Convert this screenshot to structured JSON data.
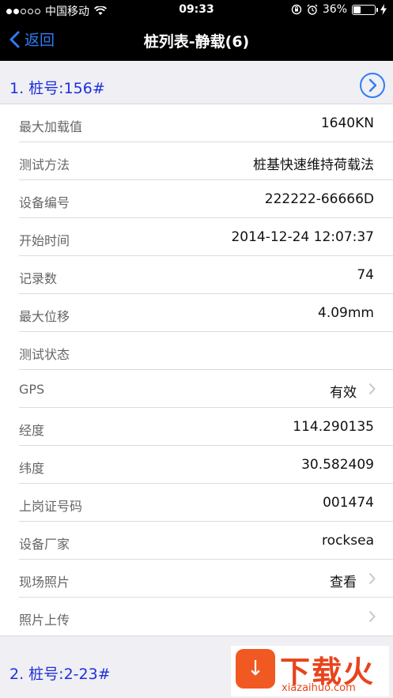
{
  "status_bar": {
    "carrier": "中国移动",
    "time": "09:33",
    "battery_percent": "36%",
    "battery_level": 0.36,
    "icons": [
      "signal-dots-icon",
      "wifi-icon",
      "rotation-lock-icon",
      "alarm-icon",
      "battery-icon",
      "charging-icon"
    ]
  },
  "nav": {
    "back_label": "返回",
    "title": "桩列表-静载(6)"
  },
  "sections": [
    {
      "title": "1. 桩号:156#",
      "rows": [
        {
          "label": "最大加载值",
          "value": "1640KN",
          "chevron": false
        },
        {
          "label": "测试方法",
          "value": "桩基快速维持荷载法",
          "chevron": false
        },
        {
          "label": "设备编号",
          "value": "222222-66666D",
          "chevron": false
        },
        {
          "label": "开始时间",
          "value": "2014-12-24 12:07:37",
          "chevron": false
        },
        {
          "label": "记录数",
          "value": "74",
          "chevron": false
        },
        {
          "label": "最大位移",
          "value": "4.09mm",
          "chevron": false
        },
        {
          "label": "测试状态",
          "value": "",
          "chevron": false
        },
        {
          "label": "GPS",
          "value": "有效",
          "chevron": true
        },
        {
          "label": "经度",
          "value": "114.290135",
          "chevron": false
        },
        {
          "label": "纬度",
          "value": "30.582409",
          "chevron": false
        },
        {
          "label": "上岗证号码",
          "value": "001474",
          "chevron": false
        },
        {
          "label": "设备厂家",
          "value": "rocksea",
          "chevron": false
        },
        {
          "label": "现场照片",
          "value": "查看",
          "chevron": true
        },
        {
          "label": "照片上传",
          "value": "",
          "chevron": true
        }
      ]
    },
    {
      "title": "2. 桩号:2-23#"
    }
  ],
  "watermark": {
    "text": "下载火",
    "sub": "xiazaihuo.com"
  },
  "colors": {
    "accent": "#2f7cf6",
    "section_title": "#1e30d8",
    "watermark": "#e8441c"
  }
}
